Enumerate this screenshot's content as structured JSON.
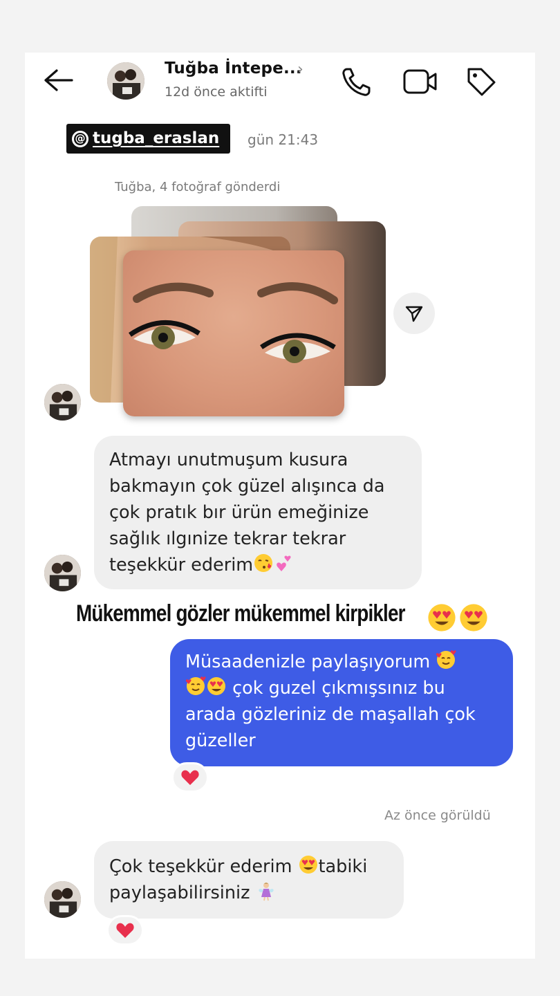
{
  "header": {
    "contact_name": "Tuğba İntepe...",
    "chevron": "›",
    "status": "12d önce aktifti",
    "icons": [
      "back-arrow-icon",
      "phone-icon",
      "video-camera-icon",
      "tag-icon"
    ]
  },
  "overlay": {
    "handle": "tugba_eraslan",
    "handle_symbol": "@",
    "timestamp_partial": "gün 21:43"
  },
  "thread": {
    "photos_notice": "Tuğba, 4 fotoğraf gönderdi",
    "photo_count": 4,
    "messages": [
      {
        "direction": "incoming",
        "text_lines": [
          "Atmayı unutmuşum kusura",
          "bakmayın çok güzel alışınca da",
          "çok pratık bır ürün emeğinize",
          "sağlık ılgınize tekrar tekrar",
          "teşekkür ederim"
        ],
        "emojis": [
          "kissing-heart-emoji",
          "two-hearts-emoji"
        ]
      },
      {
        "direction": "outgoing",
        "text_lines": [
          "Müsaadenizle paylaşıyorum",
          "çok guzel çıkmışsınız bu",
          "arada gözleriniz de maşallah çok",
          "güzeller"
        ],
        "emojis": [
          "smiling-hearts-emoji",
          "smiling-hearts-emoji",
          "heart-eyes-emoji"
        ],
        "reaction": "red-heart-emoji"
      },
      {
        "direction": "incoming",
        "text_line1_a": "Çok teşekkür ederim",
        "text_line1_b": "tabiki",
        "text_line2": "paylaşabilirsiniz",
        "emojis": [
          "heart-eyes-emoji",
          "fairy-emoji"
        ],
        "reaction": "red-heart-emoji"
      }
    ],
    "seen_status": "Az önce görüldü"
  },
  "caption": {
    "text": "Mükemmel gözler mükemmel kirpikler",
    "emojis": [
      "heart-eyes-emoji",
      "heart-eyes-emoji"
    ]
  },
  "colors": {
    "outgoing_bubble": "#3e5ce6",
    "incoming_bubble": "#efefef",
    "reaction_heart": "#e8304d"
  }
}
